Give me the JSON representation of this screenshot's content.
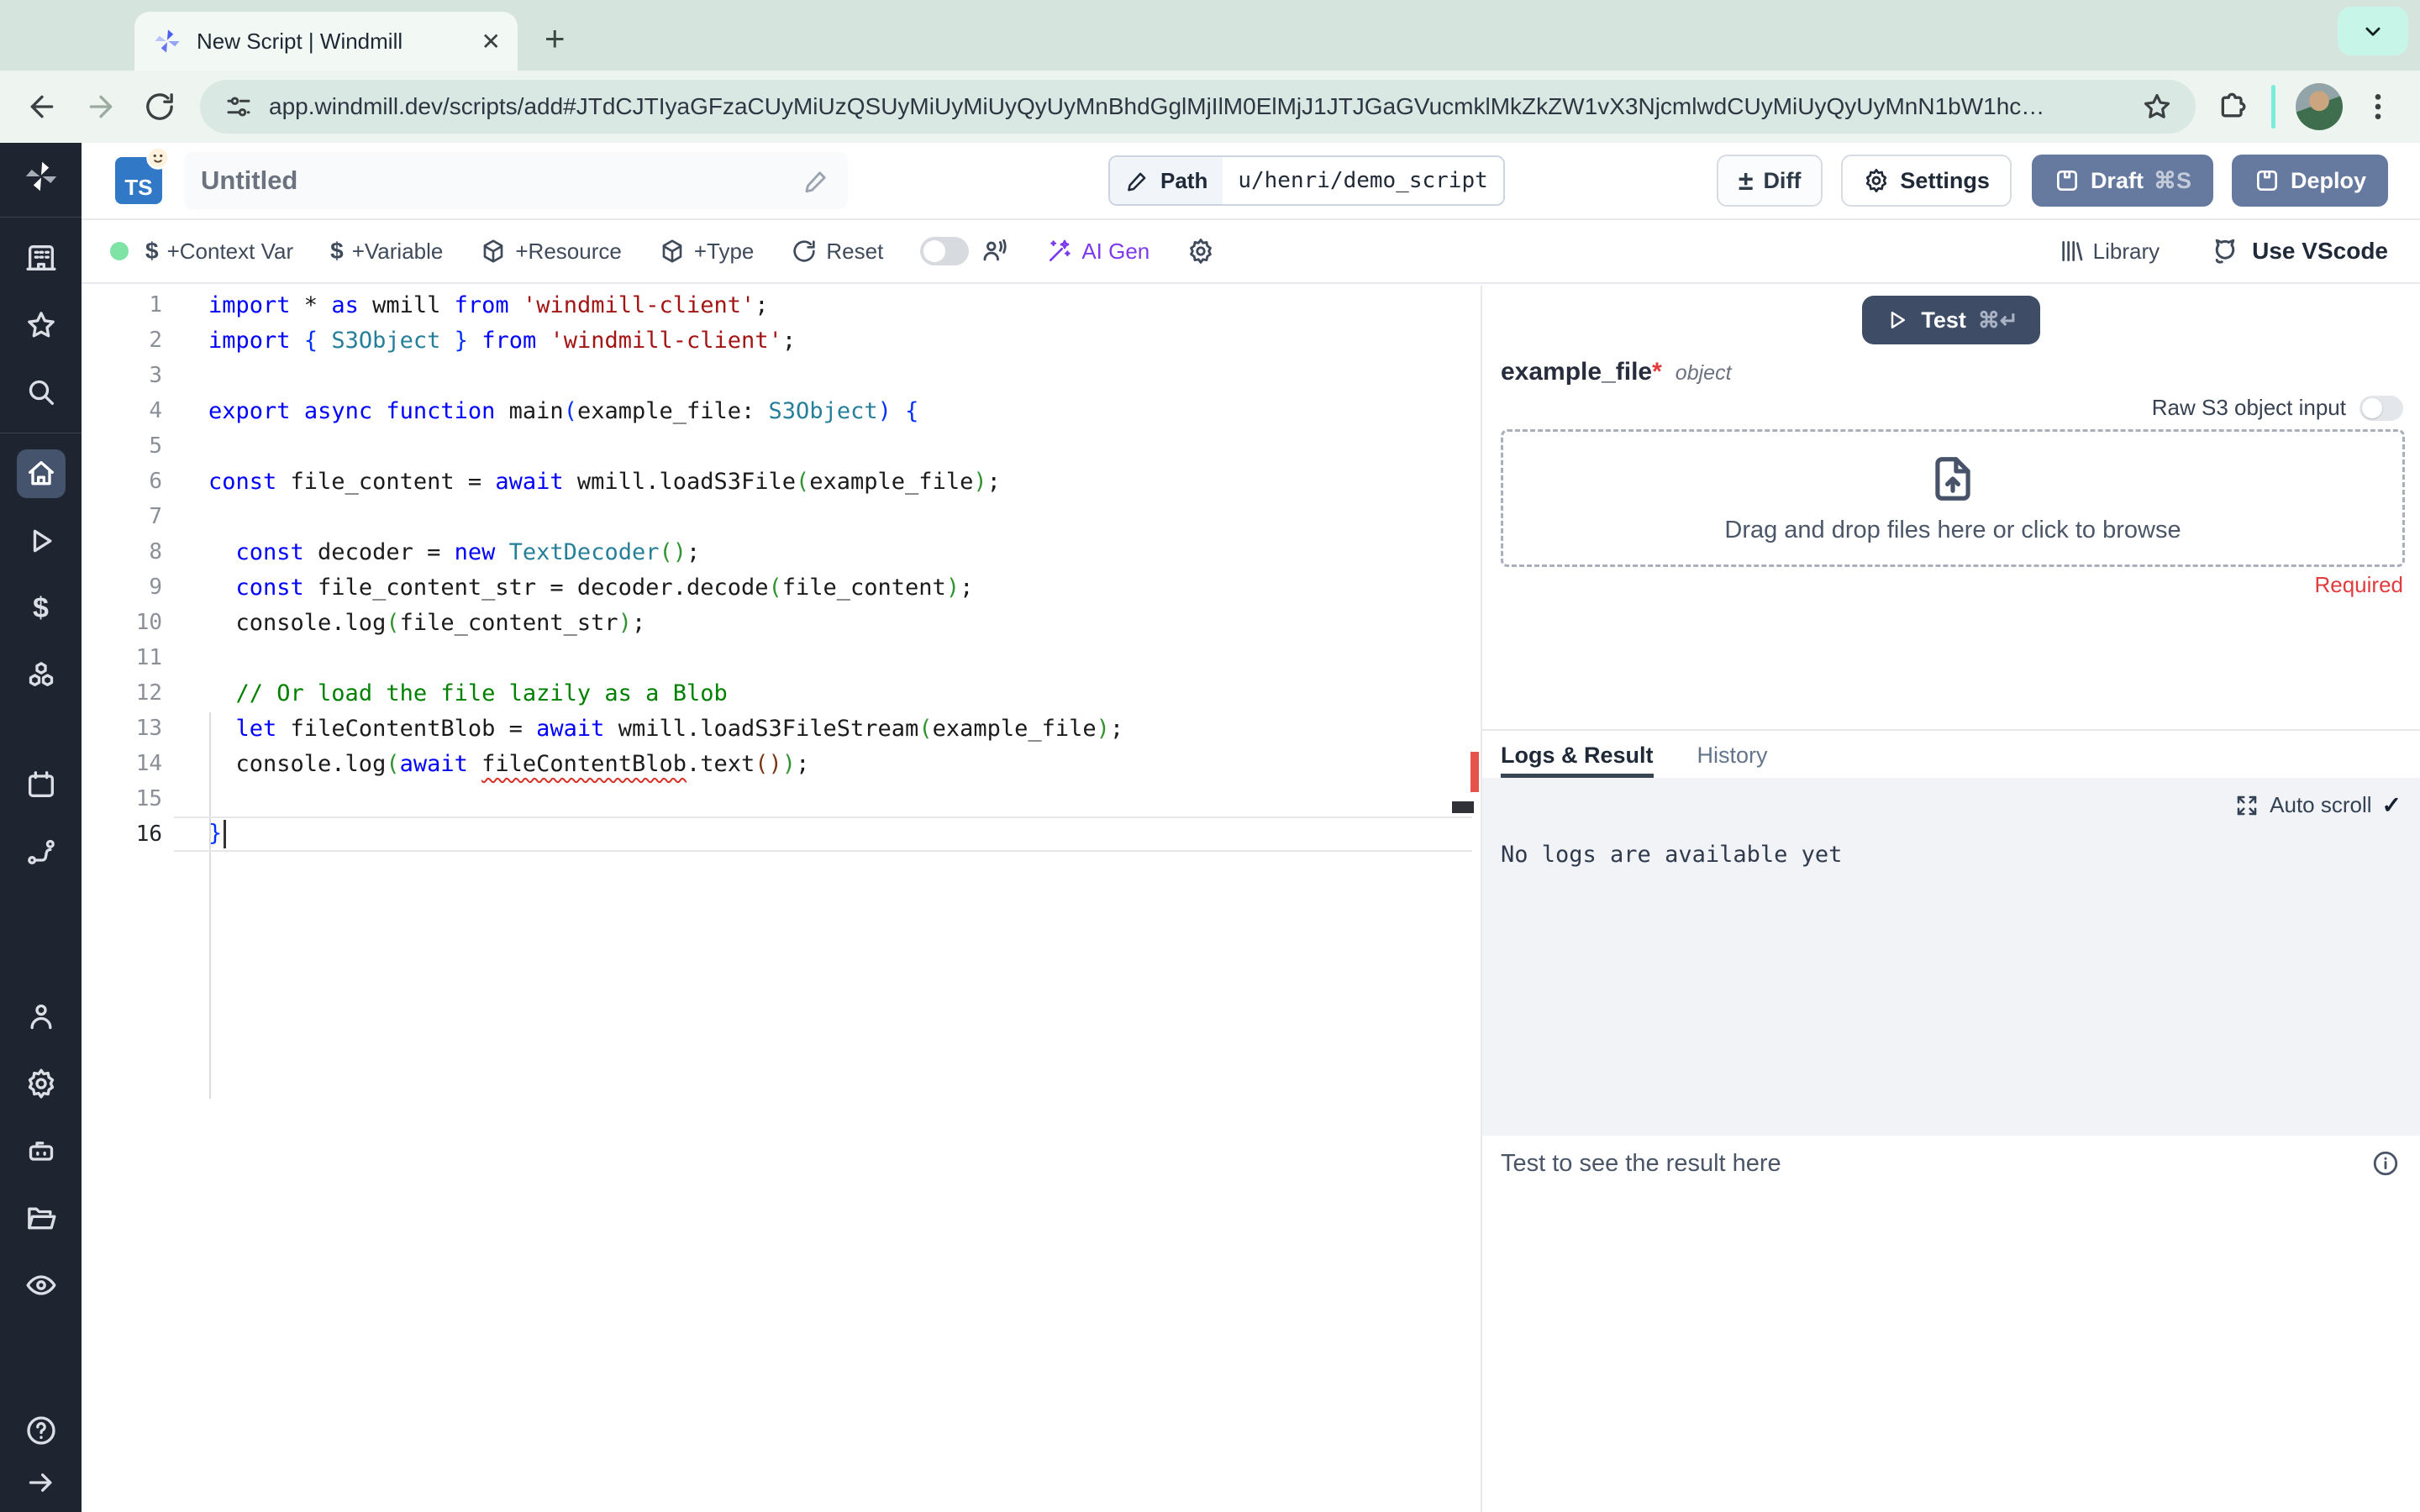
{
  "browser": {
    "tab_title": "New Script | Windmill",
    "url": "app.windmill.dev/scripts/add#JTdCJTIyaGFzaCUyMiUzQSUyMiUyMiUyQyUyMnBhdGglMjIlM0ElMjJ1JTJGaGVucmklMkZkZW1vX3NjcmlwdCUyMiUyQyUyMnN1bW1hc…",
    "close_glyph": "✕",
    "new_tab_glyph": "+"
  },
  "header": {
    "language_badge": "TS",
    "title": "Untitled",
    "path_label": "Path",
    "path_value": "u/henri/demo_script",
    "diff_label": "Diff",
    "diff_glyph": "±",
    "settings_label": "Settings",
    "draft_label": "Draft",
    "draft_shortcut": "⌘S",
    "deploy_label": "Deploy"
  },
  "toolbar": {
    "context_var": "+Context Var",
    "variable": "+Variable",
    "resource": "+Resource",
    "type": "+Type",
    "reset": "Reset",
    "ai_gen": "AI Gen",
    "library": "Library",
    "vscode": "Use VScode",
    "dollar_glyph": "$"
  },
  "editor": {
    "lines": [
      {
        "n": 1,
        "tokens": [
          [
            "import",
            "kw"
          ],
          [
            " * ",
            "pl"
          ],
          [
            "as",
            "kw"
          ],
          [
            " wmill ",
            "pl"
          ],
          [
            "from",
            "kw"
          ],
          [
            " ",
            "pl"
          ],
          [
            "'windmill-client'",
            "str"
          ],
          [
            ";",
            "pl"
          ]
        ]
      },
      {
        "n": 2,
        "tokens": [
          [
            "import",
            "kw"
          ],
          [
            " ",
            "pl"
          ],
          [
            "{",
            "b1"
          ],
          [
            " ",
            "pl"
          ],
          [
            "S3Object",
            "ty"
          ],
          [
            " ",
            "pl"
          ],
          [
            "}",
            "b1"
          ],
          [
            " ",
            "pl"
          ],
          [
            "from",
            "kw"
          ],
          [
            " ",
            "pl"
          ],
          [
            "'windmill-client'",
            "str"
          ],
          [
            ";",
            "pl"
          ]
        ]
      },
      {
        "n": 3,
        "tokens": []
      },
      {
        "n": 4,
        "tokens": [
          [
            "export",
            "kw"
          ],
          [
            " ",
            "pl"
          ],
          [
            "async",
            "kw"
          ],
          [
            " ",
            "pl"
          ],
          [
            "function",
            "kw"
          ],
          [
            " main",
            "pl"
          ],
          [
            "(",
            "b1"
          ],
          [
            "example_file",
            "pl"
          ],
          [
            ": ",
            "pl"
          ],
          [
            "S3Object",
            "ty"
          ],
          [
            ")",
            "b1"
          ],
          [
            " ",
            "pl"
          ],
          [
            "{",
            "b1"
          ]
        ]
      },
      {
        "n": 5,
        "tokens": []
      },
      {
        "n": 6,
        "tokens": [
          [
            "const",
            "kw"
          ],
          [
            " file_content = ",
            "pl"
          ],
          [
            "await",
            "kw"
          ],
          [
            " wmill.loadS3File",
            "pl"
          ],
          [
            "(",
            "b2"
          ],
          [
            "example_file",
            "pl"
          ],
          [
            ")",
            "b2"
          ],
          [
            ";",
            "pl"
          ]
        ]
      },
      {
        "n": 7,
        "tokens": []
      },
      {
        "n": 8,
        "tokens": [
          [
            "  ",
            "pl"
          ],
          [
            "const",
            "kw"
          ],
          [
            " decoder = ",
            "pl"
          ],
          [
            "new",
            "kw"
          ],
          [
            " ",
            "pl"
          ],
          [
            "TextDecoder",
            "ty"
          ],
          [
            "(",
            "b2"
          ],
          [
            ")",
            "b2"
          ],
          [
            ";",
            "pl"
          ]
        ]
      },
      {
        "n": 9,
        "tokens": [
          [
            "  ",
            "pl"
          ],
          [
            "const",
            "kw"
          ],
          [
            " file_content_str = decoder.decode",
            "pl"
          ],
          [
            "(",
            "b2"
          ],
          [
            "file_content",
            "pl"
          ],
          [
            ")",
            "b2"
          ],
          [
            ";",
            "pl"
          ]
        ]
      },
      {
        "n": 10,
        "tokens": [
          [
            "  console.log",
            "pl"
          ],
          [
            "(",
            "b2"
          ],
          [
            "file_content_str",
            "pl"
          ],
          [
            ")",
            "b2"
          ],
          [
            ";",
            "pl"
          ]
        ]
      },
      {
        "n": 11,
        "tokens": []
      },
      {
        "n": 12,
        "tokens": [
          [
            "  ",
            "pl"
          ],
          [
            "// Or load the file lazily as a Blob",
            "cm"
          ]
        ]
      },
      {
        "n": 13,
        "tokens": [
          [
            "  ",
            "pl"
          ],
          [
            "let",
            "kw"
          ],
          [
            " fileContentBlob = ",
            "pl"
          ],
          [
            "await",
            "kw"
          ],
          [
            " wmill.loadS3FileStream",
            "pl"
          ],
          [
            "(",
            "b2"
          ],
          [
            "example_file",
            "pl"
          ],
          [
            ")",
            "b2"
          ],
          [
            ";",
            "pl"
          ]
        ]
      },
      {
        "n": 14,
        "tokens": [
          [
            "  console.log",
            "pl"
          ],
          [
            "(",
            "b2"
          ],
          [
            "await",
            "kw"
          ],
          [
            " ",
            "pl"
          ],
          [
            "fileContentBlob",
            "sq"
          ],
          [
            ".text",
            "pl"
          ],
          [
            "(",
            "b3"
          ],
          [
            ")",
            "b3"
          ],
          [
            ")",
            "b2"
          ],
          [
            ";",
            "pl"
          ]
        ]
      },
      {
        "n": 15,
        "tokens": []
      },
      {
        "n": 16,
        "active": true,
        "cursor": true,
        "tokens": [
          [
            "}",
            "b1"
          ]
        ]
      }
    ]
  },
  "panel": {
    "test_label": "Test",
    "test_shortcut": "⌘↵",
    "arg_name": "example_file",
    "required_mark": "*",
    "arg_type": "object",
    "raw_s3_label": "Raw S3 object input",
    "dropzone_text": "Drag and drop files here or click to browse",
    "required_label": "Required",
    "tab_logs": "Logs & Result",
    "tab_history": "History",
    "auto_scroll_label": "Auto scroll",
    "check_glyph": "✓",
    "no_logs_text": "No logs are available yet",
    "result_hint": "Test to see the result here"
  },
  "sidebar": {
    "icon_names": [
      "windmill-logo",
      "workspace-icon",
      "favorites-icon",
      "search-icon",
      "home-icon",
      "runs-icon",
      "variables-icon",
      "resources-icon",
      "schedules-icon",
      "flows-icon",
      "account-icon",
      "settings-icon",
      "workers-icon",
      "folders-icon",
      "audit-icon",
      "help-icon",
      "collapse-icon"
    ]
  },
  "colors": {
    "chrome_mint": "#d5e5de",
    "accent_slate": "#66799e",
    "test_button": "#3e4c66",
    "ai_purple": "#7c3aed",
    "error_red": "#e23b3b",
    "sidebar_dark": "#1e2430",
    "active_item": "#46536d"
  }
}
